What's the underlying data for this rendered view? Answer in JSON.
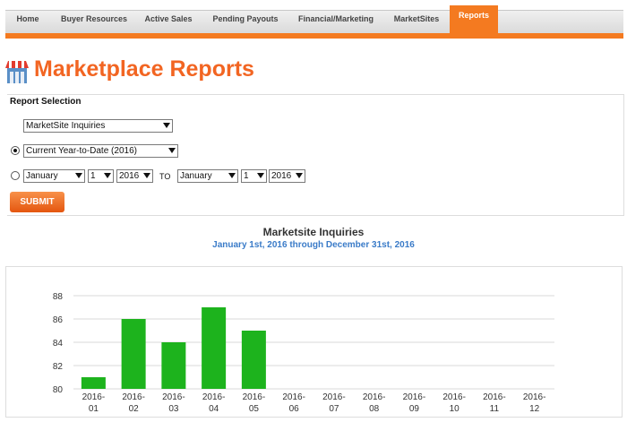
{
  "nav": {
    "tabs": [
      {
        "label": "Home",
        "active": false
      },
      {
        "label": "Buyer Resources",
        "active": false
      },
      {
        "label": "Active Sales",
        "active": false
      },
      {
        "label": "Pending Payouts",
        "active": false
      },
      {
        "label": "Financial/Marketing",
        "active": false
      },
      {
        "label": "MarketSites",
        "active": false
      },
      {
        "label": "Reports",
        "active": true
      }
    ]
  },
  "header": {
    "title": "Marketplace Reports",
    "icon": "storefront-icon"
  },
  "report_selection": {
    "label": "Report Selection",
    "report_type": "MarketSite Inquiries",
    "range_option": "Current Year-to-Date (2016)",
    "range_selected": "preset",
    "from": {
      "month": "January",
      "day": "1",
      "year": "2016"
    },
    "to_label": "TO",
    "to": {
      "month": "January",
      "day": "1",
      "year": "2016"
    },
    "submit_label": "SUBMIT"
  },
  "chart_title": "Marketsite Inquiries",
  "chart_subtitle": "January 1st, 2016 through December 31st, 2016",
  "colors": {
    "accent": "#f47a20",
    "bar": "#1db31d",
    "subtitle": "#3a7bc8"
  },
  "chart_data": {
    "type": "bar",
    "categories": [
      "2016-01",
      "2016-02",
      "2016-03",
      "2016-04",
      "2016-05",
      "2016-06",
      "2016-07",
      "2016-08",
      "2016-09",
      "2016-10",
      "2016-11",
      "2016-12"
    ],
    "values": [
      81,
      86,
      84,
      87,
      85,
      null,
      null,
      null,
      null,
      null,
      null,
      null
    ],
    "yticks": [
      80,
      82,
      84,
      86,
      88
    ],
    "ylim": [
      80,
      88
    ],
    "grid": true
  }
}
